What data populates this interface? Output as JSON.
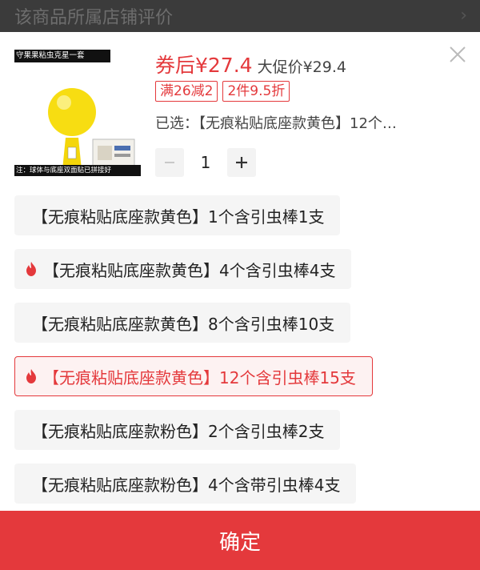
{
  "background_page": {
    "title": "该商品所属店铺评价"
  },
  "product": {
    "image_title": "守果果粘虫克星一套",
    "image_note": "注：球体与底座双面贴已拼接好",
    "price_after_coupon": "券后¥27.4",
    "promo_price": "大促价¥29.4",
    "tags": [
      "满26减2",
      "2件9.5折"
    ],
    "selected_text": "已选：【无痕粘贴底座款黄色】12个…",
    "quantity": "1",
    "qty_minus": "−",
    "qty_plus": "+"
  },
  "options": [
    {
      "label": "【无痕粘贴底座款黄色】1个含引虫棒1支",
      "hot": false,
      "selected": false
    },
    {
      "label": "【无痕粘贴底座款黄色】4个含引虫棒4支",
      "hot": true,
      "selected": false
    },
    {
      "label": "【无痕粘贴底座款黄色】8个含引虫棒10支",
      "hot": false,
      "selected": false
    },
    {
      "label": "【无痕粘贴底座款黄色】12个含引虫棒15支",
      "hot": true,
      "selected": true
    },
    {
      "label": "【无痕粘贴底座款粉色】2个含引虫棒2支",
      "hot": false,
      "selected": false
    },
    {
      "label": "【无痕粘贴底座款粉色】4个含带引虫棒4支",
      "hot": false,
      "selected": false
    }
  ],
  "confirm_label": "确定",
  "colors": {
    "accent": "#e4393c",
    "option_bg": "#f5f5f5",
    "selected_bg": "#fdf2f2"
  },
  "icons": [
    "close-icon",
    "minus-icon",
    "plus-icon",
    "flame-icon",
    "chevron-right-icon"
  ]
}
